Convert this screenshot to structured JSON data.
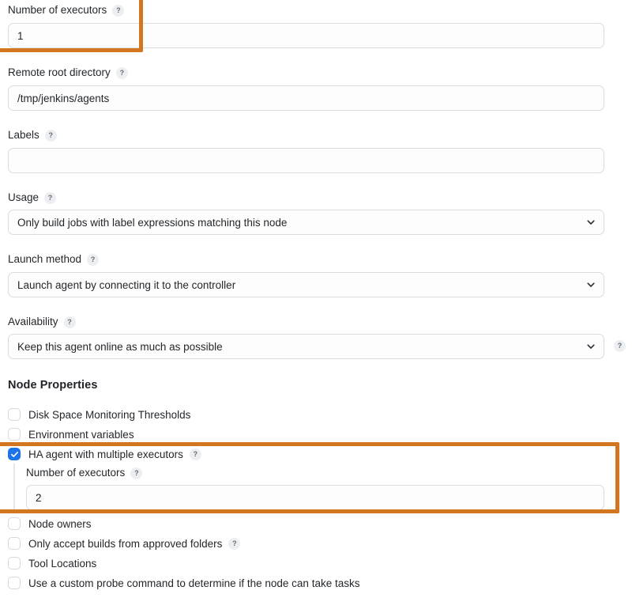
{
  "theme": {
    "highlight_color": "#d2761f",
    "checkbox_checked_color": "#1d74e8",
    "input_border_color": "#d7dce2",
    "text_color": "#23272b"
  },
  "help_glyph": "?",
  "fields": {
    "number_of_executors": {
      "label": "Number of executors",
      "value": "1",
      "has_help": true
    },
    "remote_root_directory": {
      "label": "Remote root directory",
      "value": "/tmp/jenkins/agents",
      "has_help": true
    },
    "labels": {
      "label": "Labels",
      "value": "",
      "placeholder": "",
      "has_help": true
    },
    "usage": {
      "label": "Usage",
      "value": "Only build jobs with label expressions matching this node",
      "has_help": true
    },
    "launch_method": {
      "label": "Launch method",
      "value": "Launch agent by connecting it to the controller",
      "has_help": true
    },
    "availability": {
      "label": "Availability",
      "value": "Keep this agent online as much as possible",
      "has_help": true,
      "trailing_help": true
    }
  },
  "node_properties": {
    "title": "Node Properties",
    "items": [
      {
        "label": "Disk Space Monitoring Thresholds",
        "checked": false,
        "has_help": false
      },
      {
        "label": "Environment variables",
        "checked": false,
        "has_help": false
      },
      {
        "label": "HA agent with multiple executors",
        "checked": true,
        "has_help": true
      },
      {
        "label": "Node owners",
        "checked": false,
        "has_help": false
      },
      {
        "label": "Only accept builds from approved folders",
        "checked": false,
        "has_help": true
      },
      {
        "label": "Tool Locations",
        "checked": false,
        "has_help": false
      },
      {
        "label": "Use a custom probe command to determine if the node can take tasks",
        "checked": false,
        "has_help": false
      }
    ],
    "ha_nested": {
      "label": "Number of executors",
      "value": "2",
      "has_help": true
    }
  }
}
